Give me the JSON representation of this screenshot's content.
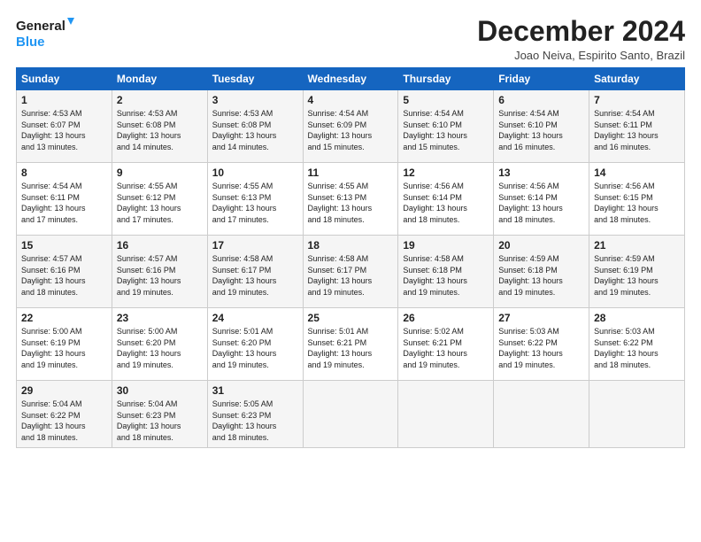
{
  "logo": {
    "line1": "General",
    "line2": "Blue"
  },
  "title": "December 2024",
  "location": "Joao Neiva, Espirito Santo, Brazil",
  "weekdays": [
    "Sunday",
    "Monday",
    "Tuesday",
    "Wednesday",
    "Thursday",
    "Friday",
    "Saturday"
  ],
  "weeks": [
    [
      {
        "day": 1,
        "info": "Sunrise: 4:53 AM\nSunset: 6:07 PM\nDaylight: 13 hours\nand 13 minutes."
      },
      {
        "day": 2,
        "info": "Sunrise: 4:53 AM\nSunset: 6:08 PM\nDaylight: 13 hours\nand 14 minutes."
      },
      {
        "day": 3,
        "info": "Sunrise: 4:53 AM\nSunset: 6:08 PM\nDaylight: 13 hours\nand 14 minutes."
      },
      {
        "day": 4,
        "info": "Sunrise: 4:54 AM\nSunset: 6:09 PM\nDaylight: 13 hours\nand 15 minutes."
      },
      {
        "day": 5,
        "info": "Sunrise: 4:54 AM\nSunset: 6:10 PM\nDaylight: 13 hours\nand 15 minutes."
      },
      {
        "day": 6,
        "info": "Sunrise: 4:54 AM\nSunset: 6:10 PM\nDaylight: 13 hours\nand 16 minutes."
      },
      {
        "day": 7,
        "info": "Sunrise: 4:54 AM\nSunset: 6:11 PM\nDaylight: 13 hours\nand 16 minutes."
      }
    ],
    [
      {
        "day": 8,
        "info": "Sunrise: 4:54 AM\nSunset: 6:11 PM\nDaylight: 13 hours\nand 17 minutes."
      },
      {
        "day": 9,
        "info": "Sunrise: 4:55 AM\nSunset: 6:12 PM\nDaylight: 13 hours\nand 17 minutes."
      },
      {
        "day": 10,
        "info": "Sunrise: 4:55 AM\nSunset: 6:13 PM\nDaylight: 13 hours\nand 17 minutes."
      },
      {
        "day": 11,
        "info": "Sunrise: 4:55 AM\nSunset: 6:13 PM\nDaylight: 13 hours\nand 18 minutes."
      },
      {
        "day": 12,
        "info": "Sunrise: 4:56 AM\nSunset: 6:14 PM\nDaylight: 13 hours\nand 18 minutes."
      },
      {
        "day": 13,
        "info": "Sunrise: 4:56 AM\nSunset: 6:14 PM\nDaylight: 13 hours\nand 18 minutes."
      },
      {
        "day": 14,
        "info": "Sunrise: 4:56 AM\nSunset: 6:15 PM\nDaylight: 13 hours\nand 18 minutes."
      }
    ],
    [
      {
        "day": 15,
        "info": "Sunrise: 4:57 AM\nSunset: 6:16 PM\nDaylight: 13 hours\nand 18 minutes."
      },
      {
        "day": 16,
        "info": "Sunrise: 4:57 AM\nSunset: 6:16 PM\nDaylight: 13 hours\nand 19 minutes."
      },
      {
        "day": 17,
        "info": "Sunrise: 4:58 AM\nSunset: 6:17 PM\nDaylight: 13 hours\nand 19 minutes."
      },
      {
        "day": 18,
        "info": "Sunrise: 4:58 AM\nSunset: 6:17 PM\nDaylight: 13 hours\nand 19 minutes."
      },
      {
        "day": 19,
        "info": "Sunrise: 4:58 AM\nSunset: 6:18 PM\nDaylight: 13 hours\nand 19 minutes."
      },
      {
        "day": 20,
        "info": "Sunrise: 4:59 AM\nSunset: 6:18 PM\nDaylight: 13 hours\nand 19 minutes."
      },
      {
        "day": 21,
        "info": "Sunrise: 4:59 AM\nSunset: 6:19 PM\nDaylight: 13 hours\nand 19 minutes."
      }
    ],
    [
      {
        "day": 22,
        "info": "Sunrise: 5:00 AM\nSunset: 6:19 PM\nDaylight: 13 hours\nand 19 minutes."
      },
      {
        "day": 23,
        "info": "Sunrise: 5:00 AM\nSunset: 6:20 PM\nDaylight: 13 hours\nand 19 minutes."
      },
      {
        "day": 24,
        "info": "Sunrise: 5:01 AM\nSunset: 6:20 PM\nDaylight: 13 hours\nand 19 minutes."
      },
      {
        "day": 25,
        "info": "Sunrise: 5:01 AM\nSunset: 6:21 PM\nDaylight: 13 hours\nand 19 minutes."
      },
      {
        "day": 26,
        "info": "Sunrise: 5:02 AM\nSunset: 6:21 PM\nDaylight: 13 hours\nand 19 minutes."
      },
      {
        "day": 27,
        "info": "Sunrise: 5:03 AM\nSunset: 6:22 PM\nDaylight: 13 hours\nand 19 minutes."
      },
      {
        "day": 28,
        "info": "Sunrise: 5:03 AM\nSunset: 6:22 PM\nDaylight: 13 hours\nand 18 minutes."
      }
    ],
    [
      {
        "day": 29,
        "info": "Sunrise: 5:04 AM\nSunset: 6:22 PM\nDaylight: 13 hours\nand 18 minutes."
      },
      {
        "day": 30,
        "info": "Sunrise: 5:04 AM\nSunset: 6:23 PM\nDaylight: 13 hours\nand 18 minutes."
      },
      {
        "day": 31,
        "info": "Sunrise: 5:05 AM\nSunset: 6:23 PM\nDaylight: 13 hours\nand 18 minutes."
      },
      null,
      null,
      null,
      null
    ]
  ]
}
